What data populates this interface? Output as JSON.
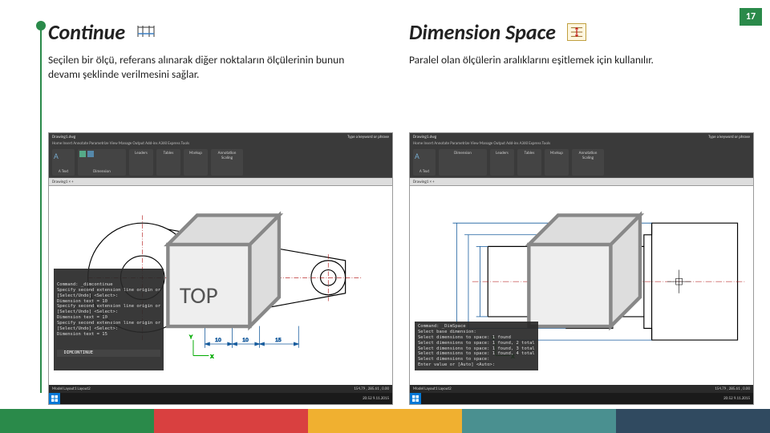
{
  "page_number": "17",
  "left": {
    "title": "Continue",
    "desc": "Seçilen bir ölçü, referans alınarak diğer noktaların ölçülerinin bunun devamı şeklinde verilmesini sağlar."
  },
  "right": {
    "title": "Dimension Space",
    "desc": "Paralel olan ölçülerin aralıklarını eşitlemek için kullanılır."
  },
  "cad": {
    "title_label": "Drawing1.dwg",
    "search_hint": "Type a keyword or phrase",
    "ribbon_tabs": "Home  Insert  Annotate  Parametrize  View  Manage  Output  Add-ins  A360  Express Tools",
    "tab_label": "Drawing1  ×  +",
    "status_left": "Model  Layout1  Layout2",
    "status_coords": "154.79 , 285.61 , 0.00",
    "clock": "20:52  9.11.2015",
    "panels": [
      "A\nText",
      "Dimension",
      "Leaders",
      "Tables",
      "Markup",
      "Annotation Scaling"
    ]
  },
  "cmd_left": "Command: _dimcontinue\nSpecify second extension line origin or\n[Select/Undo] <Select>:\nDimension text = 10\nSpecify second extension line origin or\n[Select/Undo] <Select>:\nDimension text = 10\nSpecify second extension line origin or\n[Select/Undo] <Select>:\nDimension text = 15",
  "cmd_left_input": "  DIMCONTINUE",
  "cmd_right": "Command: _DimSpace\nSelect base dimension:\nSelect dimensions to space: 1 found\nSelect dimensions to space: 1 found, 2 total\nSelect dimensions to space: 1 found, 3 total\nSelect dimensions to space: 1 found, 4 total\nSelect dimensions to space:\nEnter value or [Auto] <Auto>:",
  "dims_left": [
    "10",
    "10",
    "15"
  ],
  "footer_colors": [
    "#2a8a4a",
    "#d94040",
    "#f0b030",
    "#4a9090",
    "#304a60"
  ]
}
